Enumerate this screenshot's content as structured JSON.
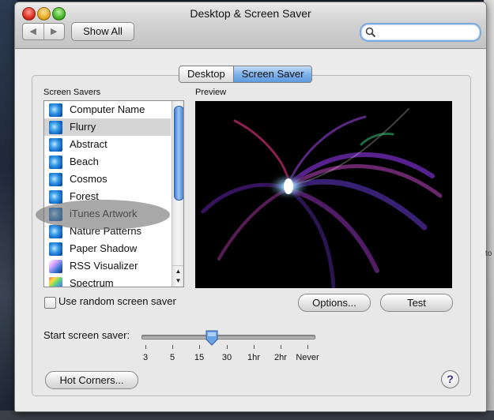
{
  "window": {
    "title": "Desktop & Screen Saver",
    "nav_back": "◀",
    "nav_forward": "▶",
    "show_all": "Show All",
    "search": {
      "value": "",
      "placeholder": ""
    }
  },
  "tabs": [
    {
      "label": "Desktop",
      "active": false
    },
    {
      "label": "Screen Saver",
      "active": true
    }
  ],
  "screen_savers": {
    "label": "Screen Savers",
    "items": [
      {
        "label": "Computer Name",
        "icon": "swirl-icon",
        "selected": false
      },
      {
        "label": "Flurry",
        "icon": "swirl-icon",
        "selected": true
      },
      {
        "label": "Abstract",
        "icon": "swirl-icon",
        "selected": false
      },
      {
        "label": "Beach",
        "icon": "swirl-icon",
        "selected": false
      },
      {
        "label": "Cosmos",
        "icon": "swirl-icon",
        "selected": false
      },
      {
        "label": "Forest",
        "icon": "swirl-icon",
        "selected": false
      },
      {
        "label": "iTunes Artwork",
        "icon": "swirl-icon",
        "selected": false
      },
      {
        "label": "Nature Patterns",
        "icon": "swirl-icon",
        "selected": false
      },
      {
        "label": "Paper Shadow",
        "icon": "swirl-icon",
        "selected": false
      },
      {
        "label": "RSS Visualizer",
        "icon": "rss-visualizer-icon",
        "selected": false
      },
      {
        "label": "Spectrum",
        "icon": "spectrum-icon",
        "selected": false
      }
    ]
  },
  "preview": {
    "label": "Preview"
  },
  "random": {
    "label": "Use random screen saver",
    "checked": false
  },
  "buttons": {
    "options": "Options...",
    "test": "Test",
    "hot_corners": "Hot Corners..."
  },
  "start": {
    "label": "Start screen saver:",
    "ticks": [
      "3",
      "5",
      "15",
      "30",
      "1hr",
      "2hr",
      "Never"
    ],
    "value_fraction": 0.41
  },
  "help": "?",
  "colors": {
    "accent": "#6aa4e6",
    "selection": "#d4d4d4"
  }
}
